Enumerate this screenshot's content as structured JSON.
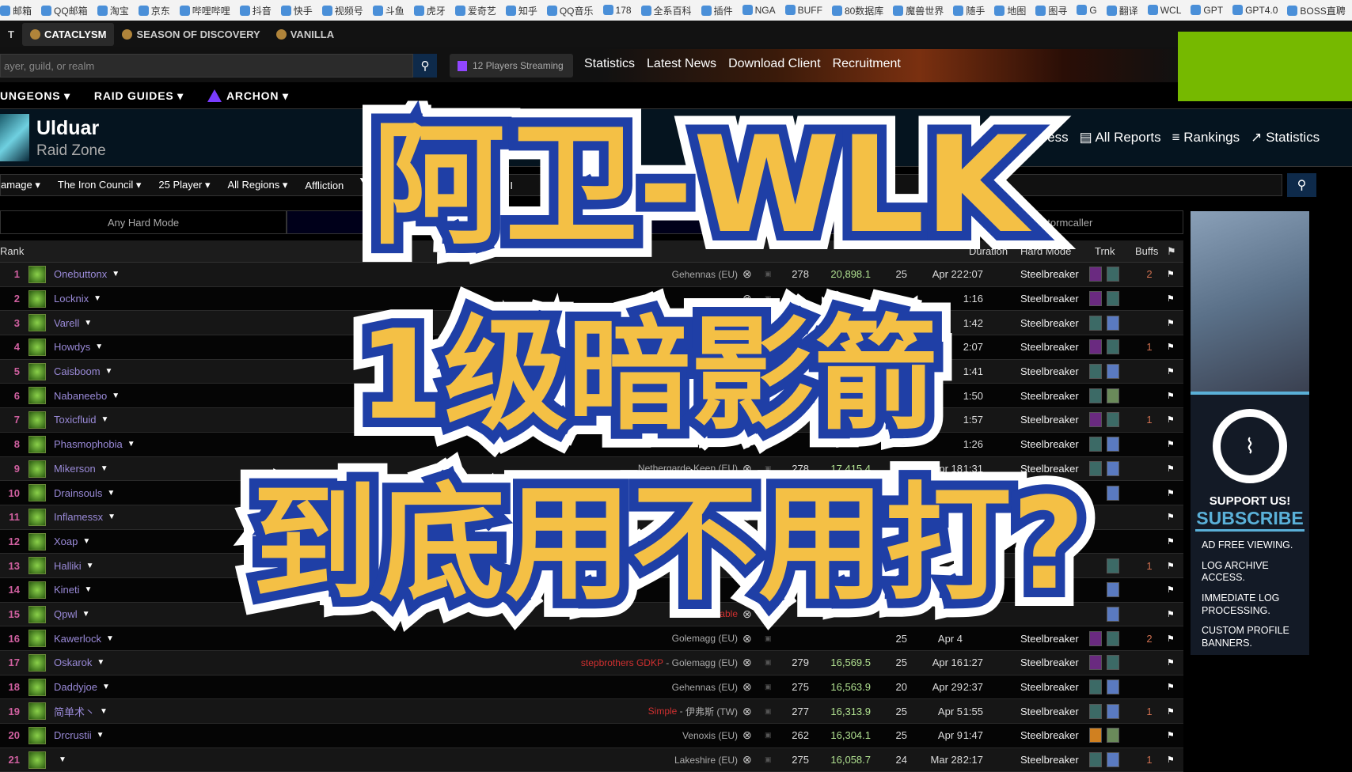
{
  "bookmarks": [
    "邮箱",
    "QQ邮箱",
    "淘宝",
    "京东",
    "哔哩哔哩",
    "抖音",
    "快手",
    "视频号",
    "斗鱼",
    "虎牙",
    "爱奇艺",
    "知乎",
    "QQ音乐",
    "178",
    "全系百科",
    "插件",
    "NGA",
    "BUFF",
    "80数据库",
    "魔兽世界",
    "随手",
    "地图",
    "图寻",
    "G",
    "翻译",
    "WCL",
    "GPT",
    "GPT4.0",
    "BOSS直聘",
    "»"
  ],
  "games": [
    "T",
    "CATACLYSM",
    "SEASON OF DISCOVERY",
    "VANILLA"
  ],
  "search": {
    "placeholder": "ayer, guild, or realm",
    "streaming": "12 Players Streaming"
  },
  "top_links": [
    "Statistics",
    "Latest News",
    "Download Client",
    "Recruitment"
  ],
  "nav": [
    "UNGEONS ▾",
    "RAID GUIDES ▾",
    "ARCHON ▾"
  ],
  "zone": {
    "title": "Ulduar",
    "subtitle": "Raid Zone",
    "links": [
      "Progress",
      "All Reports",
      "Rankings",
      "Statistics"
    ]
  },
  "filters": [
    "amage ▾",
    "The Iron Council ▾",
    "25 Player ▾",
    "All Regions ▾",
    "Affliction",
    "All I"
  ],
  "tabs": [
    "Any Hard Mode",
    "",
    "Stormcaller"
  ],
  "table": {
    "headers": {
      "rank": "Rank",
      "duration": "Duration",
      "hard_mode": "Hard Mode",
      "trinkets": "Trnk",
      "buffs": "Buffs",
      "flag": "⚑"
    },
    "rows": [
      {
        "rank": "1",
        "name": "Onebuttonx",
        "guild": "",
        "server": "Gehennas (EU)",
        "ilvl": "278",
        "dps": "20,898.1",
        "size": "25",
        "date": "Apr 22",
        "duration": "2:07",
        "hard_mode": "Steelbreaker",
        "trinkets": [
          "purple",
          "teal"
        ],
        "buffs": "2"
      },
      {
        "rank": "2",
        "name": "Locknix",
        "guild": "",
        "server": "",
        "ilvl": "",
        "dps": "",
        "size": "",
        "date": "",
        "duration": "1:16",
        "hard_mode": "Steelbreaker",
        "trinkets": [
          "purple",
          "teal"
        ],
        "buffs": ""
      },
      {
        "rank": "3",
        "name": "Varell",
        "guild": "",
        "server": "",
        "ilvl": "",
        "dps": "",
        "size": "",
        "date": "",
        "duration": "1:42",
        "hard_mode": "Steelbreaker",
        "trinkets": [
          "teal",
          "blue"
        ],
        "buffs": ""
      },
      {
        "rank": "4",
        "name": "Howdys",
        "guild": "",
        "server": "",
        "ilvl": "",
        "dps": "",
        "size": "",
        "date": "",
        "duration": "2:07",
        "hard_mode": "Steelbreaker",
        "trinkets": [
          "purple",
          "teal"
        ],
        "buffs": "1"
      },
      {
        "rank": "5",
        "name": "Caisboom",
        "guild": "",
        "server": "",
        "ilvl": "",
        "dps": "",
        "size": "",
        "date": "",
        "duration": "1:41",
        "hard_mode": "Steelbreaker",
        "trinkets": [
          "teal",
          "blue"
        ],
        "buffs": ""
      },
      {
        "rank": "6",
        "name": "Nabaneebo",
        "guild": "",
        "server": "",
        "ilvl": "",
        "dps": "",
        "size": "",
        "date": "",
        "duration": "1:50",
        "hard_mode": "Steelbreaker",
        "trinkets": [
          "teal",
          "green"
        ],
        "buffs": ""
      },
      {
        "rank": "7",
        "name": "Toxicfluid",
        "guild": "",
        "server": "",
        "ilvl": "",
        "dps": "",
        "size": "",
        "date": "",
        "duration": "1:57",
        "hard_mode": "Steelbreaker",
        "trinkets": [
          "purple",
          "teal"
        ],
        "buffs": "1"
      },
      {
        "rank": "8",
        "name": "Phasmophobia",
        "guild": "",
        "server": "",
        "ilvl": "",
        "dps": "",
        "size": "",
        "date": "",
        "duration": "1:26",
        "hard_mode": "Steelbreaker",
        "trinkets": [
          "teal",
          "blue"
        ],
        "buffs": ""
      },
      {
        "rank": "9",
        "name": "Mikerson",
        "guild": "",
        "server": "Nethergarde Keep (EU)",
        "ilvl": "278",
        "dps": "17,415.4",
        "size": "24",
        "date": "Apr 18",
        "duration": "1:31",
        "hard_mode": "Steelbreaker",
        "trinkets": [
          "teal",
          "blue"
        ],
        "buffs": ""
      },
      {
        "rank": "10",
        "name": "Drainsouls",
        "guild": "",
        "server": "",
        "ilvl": "",
        "dps": "",
        "size": "",
        "date": "",
        "duration": "",
        "hard_mode": "",
        "trinkets": [
          "",
          "blue"
        ],
        "buffs": ""
      },
      {
        "rank": "11",
        "name": "Inflamessx",
        "guild": "",
        "server": "",
        "ilvl": "",
        "dps": "",
        "size": "",
        "date": "",
        "duration": "",
        "hard_mode": "",
        "trinkets": [],
        "buffs": ""
      },
      {
        "rank": "12",
        "name": "Xoap",
        "guild": "",
        "server": "",
        "ilvl": "",
        "dps": "",
        "size": "",
        "date": "",
        "duration": "",
        "hard_mode": "",
        "trinkets": [],
        "buffs": ""
      },
      {
        "rank": "13",
        "name": "Halliki",
        "guild": "",
        "server": "",
        "ilvl": "",
        "dps": "",
        "size": "",
        "date": "",
        "duration": "",
        "hard_mode": "",
        "trinkets": [
          "",
          "teal"
        ],
        "buffs": "1"
      },
      {
        "rank": "14",
        "name": "Kineti",
        "guild": "",
        "server": "",
        "ilvl": "",
        "dps": "",
        "size": "",
        "date": "",
        "duration": "",
        "hard_mode": "",
        "trinkets": [
          "",
          "blue"
        ],
        "buffs": ""
      },
      {
        "rank": "15",
        "name": "Qpwl",
        "guild": "evable",
        "server": "",
        "ilvl": "",
        "dps": "",
        "size": "",
        "date": "",
        "duration": "",
        "hard_mode": "",
        "trinkets": [
          "",
          "blue"
        ],
        "buffs": ""
      },
      {
        "rank": "16",
        "name": "Kawerlock",
        "guild": "",
        "server": "Golemagg (EU)",
        "ilvl": "",
        "dps": "",
        "size": "25",
        "date": "Apr 4",
        "duration": "",
        "hard_mode": "Steelbreaker",
        "trinkets": [
          "purple",
          "teal"
        ],
        "buffs": "2"
      },
      {
        "rank": "17",
        "name": "Oskarok",
        "guild": "stepbrothers GDKP",
        "server": "Golemagg (EU)",
        "ilvl": "279",
        "dps": "16,569.5",
        "size": "25",
        "date": "Apr 16",
        "duration": "1:27",
        "hard_mode": "Steelbreaker",
        "trinkets": [
          "purple",
          "teal"
        ],
        "buffs": ""
      },
      {
        "rank": "18",
        "name": "Daddyjoe",
        "guild": "",
        "server": "Gehennas (EU)",
        "ilvl": "275",
        "dps": "16,563.9",
        "size": "20",
        "date": "Apr 29",
        "duration": "2:37",
        "hard_mode": "Steelbreaker",
        "trinkets": [
          "teal",
          "blue"
        ],
        "buffs": ""
      },
      {
        "rank": "19",
        "name": "简单术丶",
        "guild": "Simple",
        "server": "伊弗斯 (TW)",
        "ilvl": "277",
        "dps": "16,313.9",
        "size": "25",
        "date": "Apr 5",
        "duration": "1:55",
        "hard_mode": "Steelbreaker",
        "trinkets": [
          "teal",
          "blue"
        ],
        "buffs": "1"
      },
      {
        "rank": "20",
        "name": "Drcrustii",
        "guild": "",
        "server": "Venoxis (EU)",
        "ilvl": "262",
        "dps": "16,304.1",
        "size": "25",
        "date": "Apr 9",
        "duration": "1:47",
        "hard_mode": "Steelbreaker",
        "trinkets": [
          "fire",
          "green"
        ],
        "buffs": ""
      },
      {
        "rank": "21",
        "name": "",
        "guild": "",
        "server": "Lakeshire (EU)",
        "ilvl": "275",
        "dps": "16,058.7",
        "size": "24",
        "date": "Mar 28",
        "duration": "2:17",
        "hard_mode": "Steelbreaker",
        "trinkets": [
          "teal",
          "blue"
        ],
        "buffs": "1"
      }
    ]
  },
  "ad": {
    "support": "SUPPORT US!",
    "subscribe": "SUBSCRIBE",
    "perks": [
      "AD FREE VIEWING.",
      "LOG ARCHIVE ACCESS.",
      "IMMEDIATE LOG PROCESSING.",
      "CUSTOM PROFILE BANNERS."
    ]
  },
  "overlay": {
    "line1": "阿卫-WLK",
    "line2": "1级暗影箭",
    "line3": "到底用不用打?"
  },
  "colors": {
    "accent": "#0e2a4a",
    "overlay_fill": "#f4c045",
    "overlay_stroke": "#1f3fa6",
    "green_box": "#76b900",
    "trinkets": {
      "purple": "#6a2a80",
      "teal": "#3c6a66",
      "blue": "#5a7ac0",
      "green": "#6a8a5a",
      "fire": "#d08020"
    }
  }
}
